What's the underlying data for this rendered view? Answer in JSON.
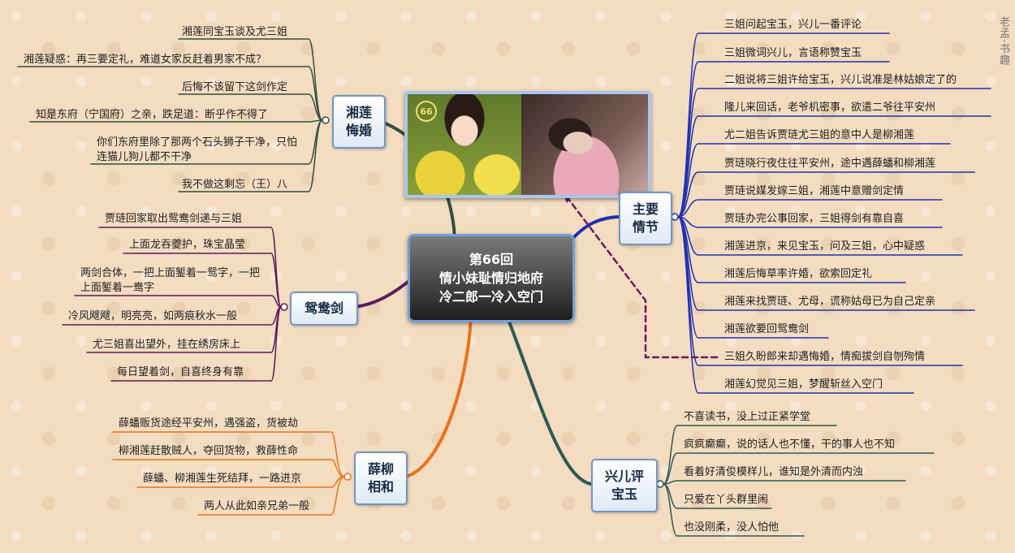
{
  "center": {
    "line1": "第66回",
    "line2": "情小妹耻情归地府",
    "line3": "冷二郎一冷入空门"
  },
  "photo": {
    "episode_badge": "66"
  },
  "watermark": "老孟·书趣",
  "branches": {
    "xianglian_huihun": {
      "label": "湘莲悔婚",
      "items": [
        "湘莲同宝玉谈及尤三姐",
        "湘莲疑惑：再三要定礼，难道女家反赶着男家不成？",
        "后悔不该留下这剑作定",
        "知是东府（宁国府）之亲，跌足道：断乎作不得了",
        "你们东府里除了那两个石头狮子干净，只怕连猫儿狗儿都不干净",
        "我不做这剩忘（王）八"
      ]
    },
    "yuanyang_jian": {
      "label": "鸳鸯剑",
      "items": [
        "贾琏回家取出鸳鸯剑递与三姐",
        "上面龙吞夔护，珠宝晶莹",
        "两剑合体，一把上面錾着一鸳字，一把上面錾着一鸯字",
        "冷风飕飕，明亮亮，如两痕秋水一般",
        "尤三姐喜出望外，挂在绣房床上",
        "每日望着剑，自喜终身有靠"
      ]
    },
    "xueliu_xianghe": {
      "label": "薛柳相和",
      "items": [
        "薛蟠贩货途经平安州，遇强盗，货被劫",
        "柳湘莲赶散贼人，夺回货物，救薛性命",
        "薛蟠、柳湘莲生死结拜，一路进京",
        "两人从此如亲兄弟一般"
      ]
    },
    "zhuyao_qingjie": {
      "label": "主要情节",
      "items": [
        "三姐问起宝玉，兴儿一番评论",
        "三姐微词兴儿，言语称赞宝玉",
        "二姐说将三姐许给宝玉，兴儿说准是林姑娘定了的",
        "隆儿来回话，老爷机密事，欲遣二爷往平安州",
        "尤二姐告诉贾琏尤三姐的意中人是柳湘莲",
        "贾琏晓行夜住往平安州，途中遇薛蟠和柳湘莲",
        "贾琏说媒发嫁三姐，湘莲中意赠剑定情",
        "贾琏办完公事回家，三姐得剑有靠自喜",
        "湘莲进京，来见宝玉，问及三姐，心中疑惑",
        "湘莲后悔草率许婚，欲索回定礼",
        "湘莲来找贾琏、尤母，谎称姑母已为自己定亲",
        "湘莲欲要回鸳鸯剑",
        "三姐久盼郎来却遇悔婚，情痴拔剑自刎殉情",
        "湘莲幻觉见三姐，梦醒斩丝入空门"
      ]
    },
    "xinger_ping_baoyu": {
      "label": "兴儿评宝玉",
      "items": [
        "不喜读书，没上过正紧学堂",
        "疯疯癫癫，说的话人也不懂，干的事人也不知",
        "看着好清俊模样儿，谁知是外清而内浊",
        "只爱在丫头群里闹",
        "也没刚柔，没人怕他"
      ]
    }
  },
  "colors": {
    "xianglian": "#2f4f3f",
    "yuanyang": "#5a1c5e",
    "xueliu": "#e8731a",
    "zhuyao": "#2030b0",
    "xinger": "#2f5a55",
    "dashed": "#6a1a60"
  }
}
